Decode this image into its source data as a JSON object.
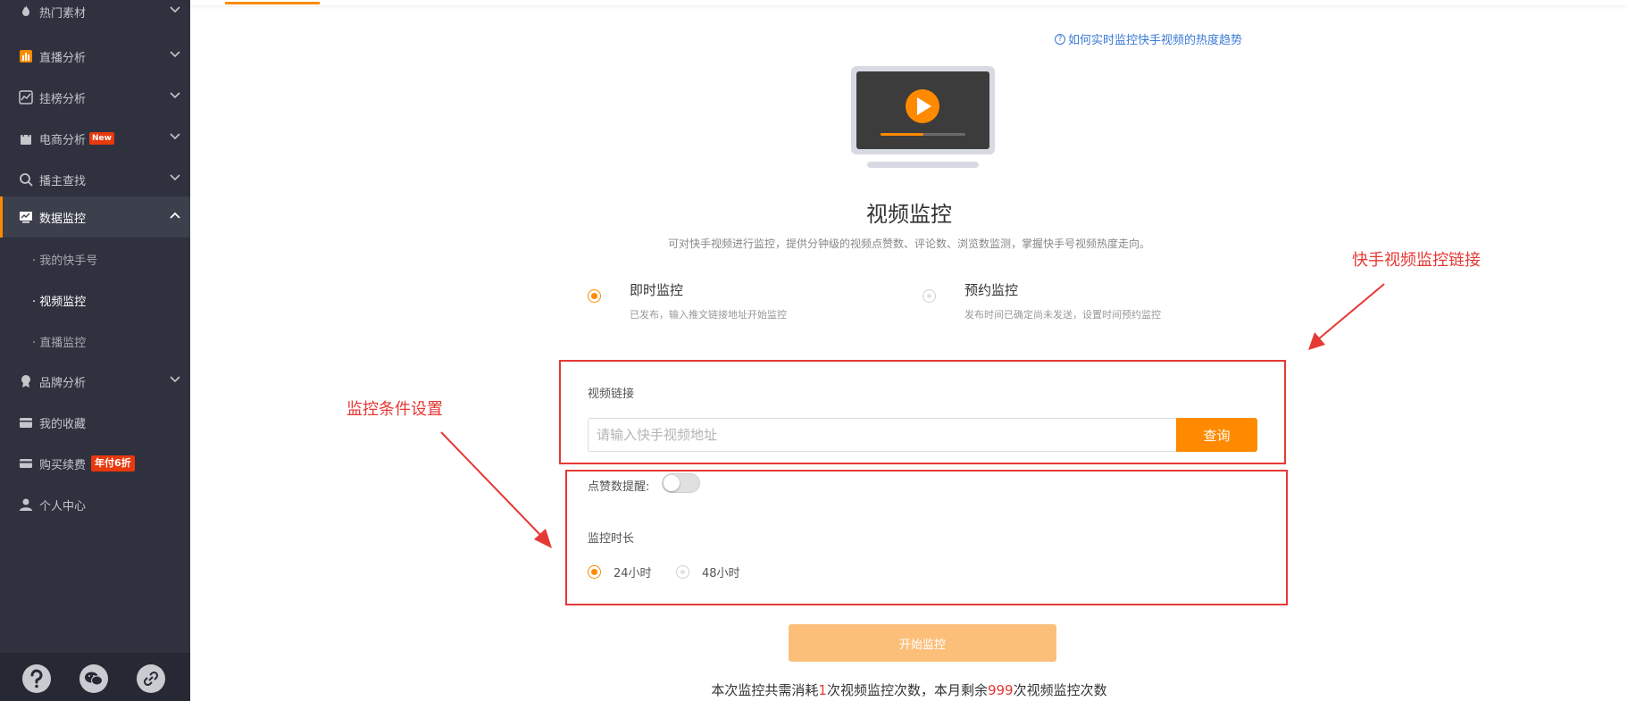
{
  "sidebar": {
    "items": [
      {
        "label": "热门素材",
        "icon": "fire-icon"
      },
      {
        "label": "直播分析",
        "icon": "bar-chart-icon"
      },
      {
        "label": "挂榜分析",
        "icon": "trend-icon"
      },
      {
        "label": "电商分析",
        "icon": "shopping-bag-icon",
        "badge": "New"
      },
      {
        "label": "播主查找",
        "icon": "search-icon"
      },
      {
        "label": "数据监控",
        "icon": "monitor-icon"
      },
      {
        "label": "品牌分析",
        "icon": "brand-icon"
      },
      {
        "label": "我的收藏",
        "icon": "wallet-icon"
      },
      {
        "label": "购买续费",
        "icon": "card-icon",
        "badge": "年付6折"
      },
      {
        "label": "个人中心",
        "icon": "user-icon"
      }
    ],
    "sub_items": [
      "· 我的快手号",
      "· 视频监控",
      "· 直播监控"
    ],
    "footer_icons": [
      "help-icon",
      "wechat-icon",
      "link-icon"
    ]
  },
  "help_link": "如何实时监控快手视频的热度趋势",
  "page": {
    "title": "视频监控",
    "description": "可对快手视频进行监控，提供分钟级的视频点赞数、评论数、浏览数监测，掌握快手号视频热度走向。"
  },
  "modes": [
    {
      "title": "即时监控",
      "desc": "已发布，输入推文链接地址开始监控",
      "selected": true
    },
    {
      "title": "预约监控",
      "desc": "发布时间已确定尚未发送，设置时间预约监控",
      "selected": false
    }
  ],
  "form": {
    "link_label": "视频链接",
    "link_placeholder": "请输入快手视频地址",
    "query_button": "查询",
    "like_alert_label": "点赞数提醒:",
    "like_alert_on": false,
    "duration_label": "监控时长",
    "durations": [
      {
        "label": "24小时",
        "selected": true
      },
      {
        "label": "48小时",
        "selected": false
      }
    ],
    "start_button": "开始监控"
  },
  "cost": {
    "prefix": "本次监控共需消耗",
    "count": "1",
    "middle": "次视频监控次数，本月剩余",
    "remaining": "999",
    "suffix": "次视频监控次数"
  },
  "annotations": {
    "link": "快手视频监控链接",
    "conditions": "监控条件设置"
  },
  "colors": {
    "accent": "#ff8a00",
    "annotation": "#e53935",
    "sidebar_bg": "#2f323e"
  }
}
